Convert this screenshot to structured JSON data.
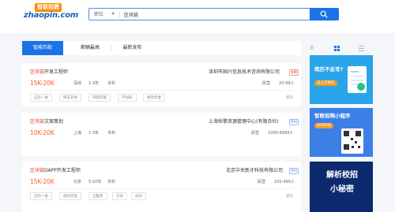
{
  "logo": {
    "top_text": "智联招聘",
    "main_text": "zhaopin.com"
  },
  "search": {
    "type_label": "职位",
    "query": "区块链"
  },
  "tabs": [
    {
      "label": "智能匹配"
    },
    {
      "label": "薪酬最高"
    },
    {
      "label": "最新发布"
    }
  ],
  "view_label": "显示方式",
  "jobs": [
    {
      "title_highlight": "区块链",
      "title_rest": "开发工程师",
      "salary": "15K-20K",
      "city": "深圳",
      "experience": "1-3年",
      "education": "本科",
      "company": "深圳市国兴信息技术咨询有限公司",
      "badge": "急聘",
      "industry": "民营",
      "size": "20-99人",
      "tags": [
        "五险一金",
        "周末双休",
        "带薪年假",
        "不加班",
        "绩效奖金"
      ],
      "time": "最新"
    },
    {
      "title_highlight": "区块链",
      "title_rest": "文案策划",
      "salary": "10K-20K",
      "city": "上海",
      "experience": "1-3年",
      "education": "本科",
      "company": "上海纵擎资源管理中心(有限合伙)",
      "badge": "PRO",
      "industry": "民营",
      "size": "1000-9999人",
      "tags": [],
      "time": "最新"
    },
    {
      "title_highlight": "区块链",
      "title_rest": "DAPP开发工程师",
      "salary": "15K-20K",
      "city": "北京",
      "experience": "5-10年",
      "education": "本科",
      "company": "北京中关新才科技有限公司",
      "badge": "PRO",
      "industry": "民营",
      "size": "100-499人",
      "tags": [
        "五险一金",
        "绩效奖金",
        "全勤奖",
        "包住",
        "房补"
      ],
      "time": "最新"
    }
  ],
  "ads": [
    {
      "title": "简历不会写?",
      "button": "马上写简历"
    },
    {
      "title": "智联招聘小程序",
      "button": "扫码体验"
    },
    {
      "line1": "解析校招",
      "line2": "小秘密"
    }
  ],
  "colors": {
    "accent": "#1a73e8",
    "salary": "#ff5722",
    "highlight": "#e53935"
  }
}
